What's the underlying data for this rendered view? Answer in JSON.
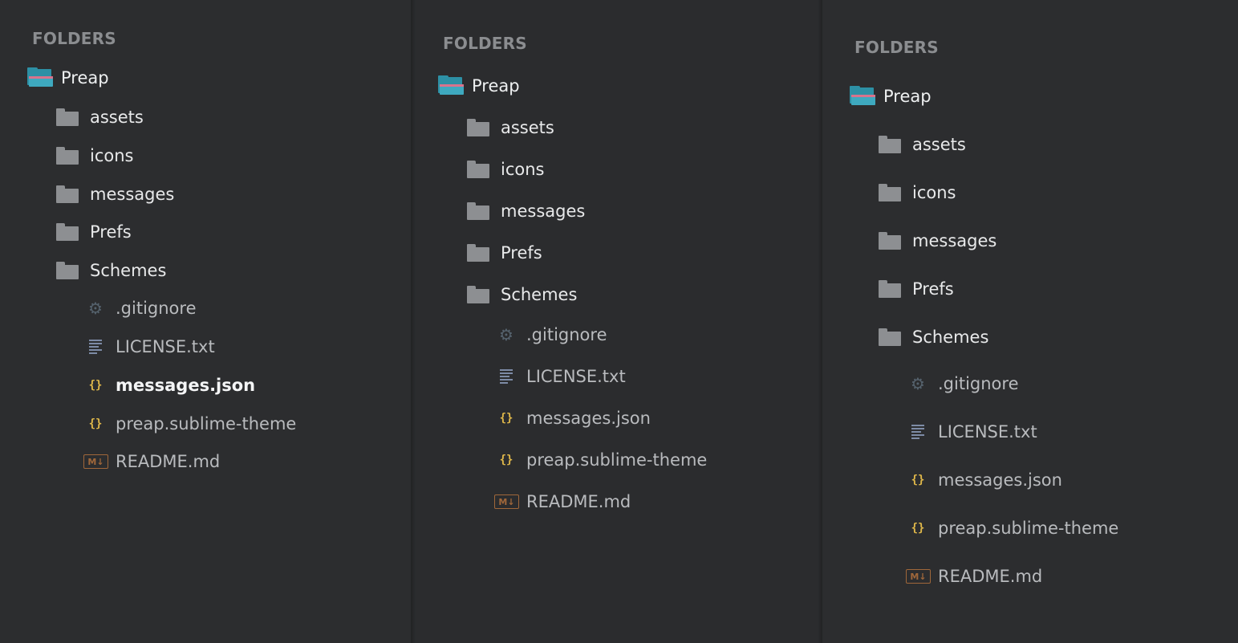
{
  "sidebar_panels": [
    {
      "header": "FOLDERS",
      "root": {
        "label": "Preap",
        "icon": "open-folder-icon"
      },
      "folders": [
        {
          "label": "assets",
          "icon": "folder-icon"
        },
        {
          "label": "icons",
          "icon": "folder-icon"
        },
        {
          "label": "messages",
          "icon": "folder-icon"
        },
        {
          "label": "Prefs",
          "icon": "folder-icon"
        },
        {
          "label": "Schemes",
          "icon": "folder-icon"
        }
      ],
      "files": [
        {
          "label": ".gitignore",
          "icon": "gear-icon"
        },
        {
          "label": "LICENSE.txt",
          "icon": "text-lines-icon"
        },
        {
          "label": "messages.json",
          "icon": "json-braces-icon",
          "active": true
        },
        {
          "label": "preap.sublime-theme",
          "icon": "json-braces-icon"
        },
        {
          "label": "README.md",
          "icon": "markdown-icon"
        }
      ]
    },
    {
      "header": "FOLDERS",
      "root": {
        "label": "Preap",
        "icon": "open-folder-icon"
      },
      "folders": [
        {
          "label": "assets",
          "icon": "folder-icon"
        },
        {
          "label": "icons",
          "icon": "folder-icon"
        },
        {
          "label": "messages",
          "icon": "folder-icon"
        },
        {
          "label": "Prefs",
          "icon": "folder-icon"
        },
        {
          "label": "Schemes",
          "icon": "folder-icon"
        }
      ],
      "files": [
        {
          "label": ".gitignore",
          "icon": "gear-icon"
        },
        {
          "label": "LICENSE.txt",
          "icon": "text-lines-icon"
        },
        {
          "label": "messages.json",
          "icon": "json-braces-icon"
        },
        {
          "label": "preap.sublime-theme",
          "icon": "json-braces-icon"
        },
        {
          "label": "README.md",
          "icon": "markdown-icon"
        }
      ]
    },
    {
      "header": "FOLDERS",
      "root": {
        "label": "Preap",
        "icon": "open-folder-icon"
      },
      "folders": [
        {
          "label": "assets",
          "icon": "folder-icon"
        },
        {
          "label": "icons",
          "icon": "folder-icon"
        },
        {
          "label": "messages",
          "icon": "folder-icon"
        },
        {
          "label": "Prefs",
          "icon": "folder-icon"
        },
        {
          "label": "Schemes",
          "icon": "folder-icon"
        }
      ],
      "files": [
        {
          "label": ".gitignore",
          "icon": "gear-icon"
        },
        {
          "label": "LICENSE.txt",
          "icon": "text-lines-icon"
        },
        {
          "label": "messages.json",
          "icon": "json-braces-icon"
        },
        {
          "label": "preap.sublime-theme",
          "icon": "json-braces-icon"
        },
        {
          "label": "README.md",
          "icon": "markdown-icon"
        }
      ]
    }
  ],
  "icon_glyphs": {
    "braces": "{}",
    "markdown": "M↓",
    "gear": "⚙"
  },
  "colors": {
    "background": "#2c2d2f",
    "header_text": "#8b8d90",
    "folder_icon": "#8d8f92",
    "open_folder": "#3ea9bf",
    "open_folder_stripe": "#d9738c",
    "json_braces": "#e0b84a",
    "markdown_icon": "#a0673a",
    "gear_icon": "#55626d"
  }
}
